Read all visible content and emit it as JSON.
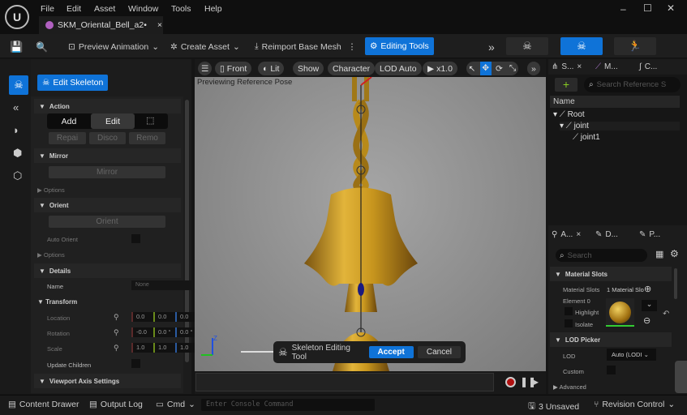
{
  "menu": [
    "File",
    "Edit",
    "Asset",
    "Window",
    "Tools",
    "Help"
  ],
  "window_controls": {
    "minimize": "–",
    "maximize": "☐",
    "close": "✕"
  },
  "tab": {
    "title": "SKM_Oriental_Bell_a2•",
    "close": "×"
  },
  "toolbar": {
    "preview_animation": "Preview Animation",
    "create_asset": "Create Asset",
    "reimport": "Reimport Base Mesh",
    "editing_tools": "Editing Tools",
    "overflow": "»"
  },
  "left": {
    "edit_skeleton": "Edit Skeleton",
    "action": {
      "title": "Action",
      "add": "Add",
      "edit": "Edit",
      "repair": "Repai",
      "disconnect": "Disco",
      "remove": "Remo"
    },
    "mirror": {
      "title": "Mirror",
      "button": "Mirror",
      "options": "Options"
    },
    "orient": {
      "title": "Orient",
      "button": "Orient",
      "auto_orient": "Auto Orient",
      "options": "Options"
    },
    "details": {
      "title": "Details",
      "name_label": "Name",
      "name_value": "None"
    },
    "transform": {
      "title": "Transform",
      "location": "Location",
      "rotation": "Rotation",
      "scale": "Scale",
      "update_children": "Update Children",
      "location_values": [
        "0.0",
        "0.0",
        "0.0"
      ],
      "rotation_values": [
        "-0.0",
        "0.0 °",
        "0.0 °"
      ],
      "scale_values": [
        "1.0",
        "1.0",
        "1.0"
      ]
    },
    "viewport_axis": "Viewport Axis Settings"
  },
  "viewport": {
    "front": "Front",
    "lit": "Lit",
    "show": "Show",
    "character": "Character",
    "lod": "LOD Auto",
    "speed": "x1.0",
    "overlay": "Previewing Reference Pose",
    "axis_z": "Z",
    "tool_label": "Skeleton Editing Tool",
    "accept": "Accept",
    "cancel": "Cancel"
  },
  "right": {
    "tabs": [
      "S...",
      "M...",
      "C..."
    ],
    "search_placeholder": "Search Reference S",
    "column": "Name",
    "tree": [
      "Root",
      "joint",
      "joint1"
    ],
    "details_tabs": [
      "A...",
      "D...",
      "P..."
    ],
    "details_search": "Search",
    "material_slots": {
      "title": "Material Slots",
      "label": "Material Slots",
      "value": "1 Material Slo",
      "element": "Element 0",
      "highlight": "Highlight",
      "isolate": "Isolate"
    },
    "lod_picker": {
      "title": "LOD Picker",
      "lod_label": "LOD",
      "lod_value": "Auto (LODI",
      "custom": "Custom",
      "advanced": "Advanced"
    }
  },
  "status": {
    "content_drawer": "Content Drawer",
    "output_log": "Output Log",
    "cmd": "Cmd",
    "console_placeholder": "Enter Console Command",
    "unsaved": "3 Unsaved",
    "revision": "Revision Control"
  },
  "colors": {
    "accent": "#0f73d8",
    "bell": "#c8961e"
  }
}
